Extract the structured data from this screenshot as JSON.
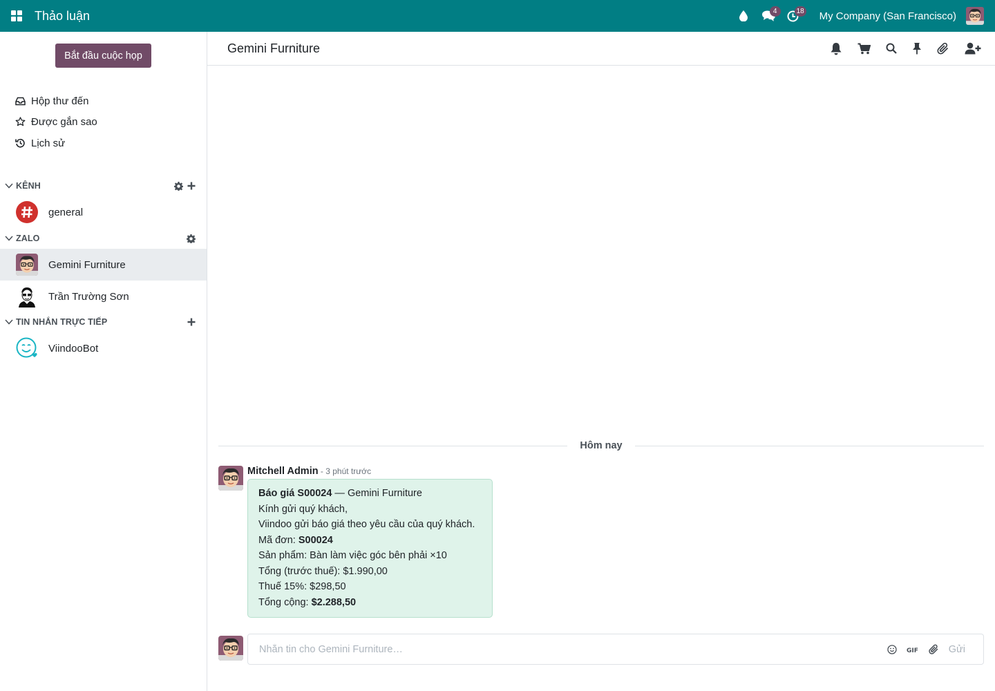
{
  "navbar": {
    "app_title": "Thảo luận",
    "messages_badge": "4",
    "activities_badge": "18",
    "company": "My Company (San Francisco)"
  },
  "sidebar": {
    "start_meeting": "Bắt đầu cuộc họp",
    "mailboxes": [
      {
        "label": "Hộp thư đến",
        "icon": "inbox-icon"
      },
      {
        "label": "Được gắn sao",
        "icon": "star-icon"
      },
      {
        "label": "Lịch sử",
        "icon": "history-icon"
      }
    ],
    "categories": {
      "channels": {
        "label": "KÊNH",
        "items": [
          {
            "label": "general"
          }
        ]
      },
      "zalo": {
        "label": "ZALO",
        "items": [
          {
            "label": "Gemini Furniture",
            "active": true
          },
          {
            "label": "Trần Trường Sơn"
          }
        ]
      },
      "direct": {
        "label": "TIN NHẮN TRỰC TIẾP",
        "items": [
          {
            "label": "ViindooBot"
          }
        ]
      }
    }
  },
  "thread": {
    "name": "Gemini Furniture",
    "date_separator": "Hôm nay",
    "message": {
      "author": "Mitchell Admin",
      "date": " - 3 phút trước",
      "title_bold": "Báo giá S00024",
      "title_rest": " — Gemini Furniture",
      "line1": "Kính gửi quý khách,",
      "line2": "Viindoo gửi báo giá theo yêu cầu của quý khách.",
      "order_label": "Mã đơn: ",
      "order_value": "S00024",
      "product": "Sản phẩm: Bàn làm việc góc bên phải ×10",
      "subtotal": "Tổng (trước thuế): $1.990,00",
      "tax": "Thuế 15%: $298,50",
      "total_label": "Tổng cộng: ",
      "total_value": "$2.288,50"
    },
    "composer": {
      "placeholder": "Nhắn tin cho Gemini Furniture…",
      "send": "Gửi"
    }
  },
  "colors": {
    "navbar": "#017e84",
    "primary": "#714b67",
    "bubble": "#dff3ea"
  }
}
